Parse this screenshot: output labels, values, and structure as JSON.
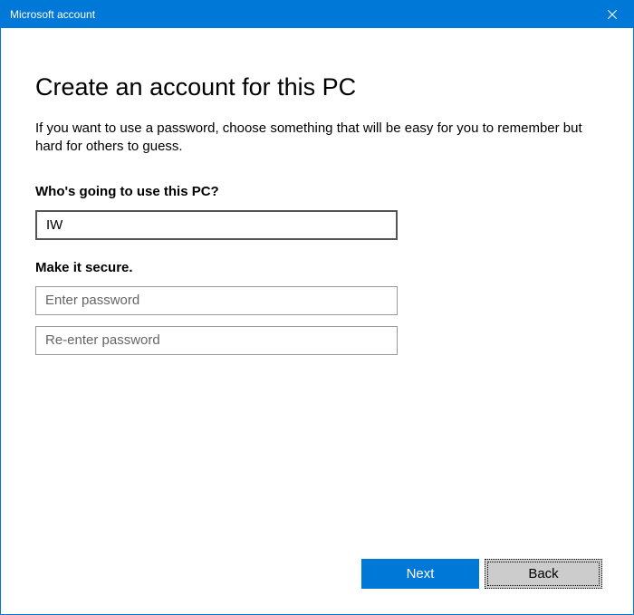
{
  "window": {
    "title": "Microsoft account"
  },
  "page": {
    "heading": "Create an account for this PC",
    "description": "If you want to use a password, choose something that will be easy for you to remember but hard for others to guess."
  },
  "sections": {
    "username_label": "Who's going to use this PC?",
    "username_value": "IW",
    "secure_label": "Make it secure.",
    "password_placeholder": "Enter password",
    "reenter_placeholder": "Re-enter password"
  },
  "buttons": {
    "next": "Next",
    "back": "Back"
  }
}
